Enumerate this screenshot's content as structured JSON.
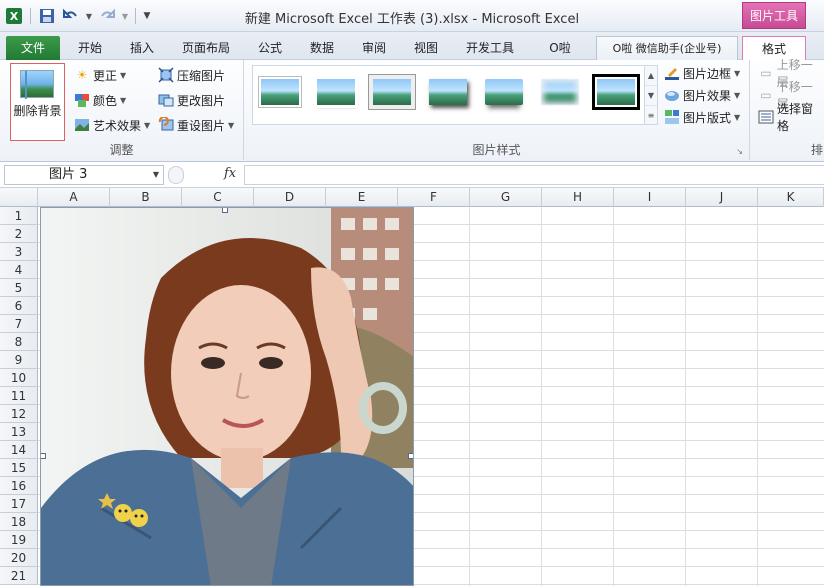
{
  "window": {
    "title": "新建 Microsoft Excel 工作表 (3).xlsx - Microsoft Excel",
    "context_tab_header": "图片工具"
  },
  "ribbon_tabs": [
    {
      "label": "文件"
    },
    {
      "label": "开始"
    },
    {
      "label": "插入"
    },
    {
      "label": "页面布局"
    },
    {
      "label": "公式"
    },
    {
      "label": "数据"
    },
    {
      "label": "审阅"
    },
    {
      "label": "视图"
    },
    {
      "label": "开发工具"
    },
    {
      "label": "O啦"
    },
    {
      "label": "O啦 微信助手(企业号)"
    },
    {
      "label": "格式"
    }
  ],
  "adjust_group": {
    "label": "调整",
    "remove_bg": "删除背景",
    "corrections": "更正",
    "color": "颜色",
    "artistic": "艺术效果",
    "compress": "压缩图片",
    "change": "更改图片",
    "reset": "重设图片"
  },
  "styles_group": {
    "label": "图片样式",
    "border": "图片边框",
    "effects": "图片效果",
    "layout": "图片版式"
  },
  "arrange_group": {
    "forward": "上移一层",
    "backward": "下移一层",
    "selection_pane": "选择窗格",
    "label_fragment": "排"
  },
  "formula_bar": {
    "name_box": "图片 3",
    "fx": "fx",
    "formula": ""
  },
  "columns": [
    "A",
    "B",
    "C",
    "D",
    "E",
    "F",
    "G",
    "H",
    "I",
    "J",
    "K"
  ],
  "rows": [
    "1",
    "2",
    "3",
    "4",
    "5",
    "6",
    "7",
    "8",
    "9",
    "10",
    "11",
    "12",
    "13",
    "14",
    "15",
    "16",
    "17",
    "18",
    "19",
    "20",
    "21"
  ]
}
